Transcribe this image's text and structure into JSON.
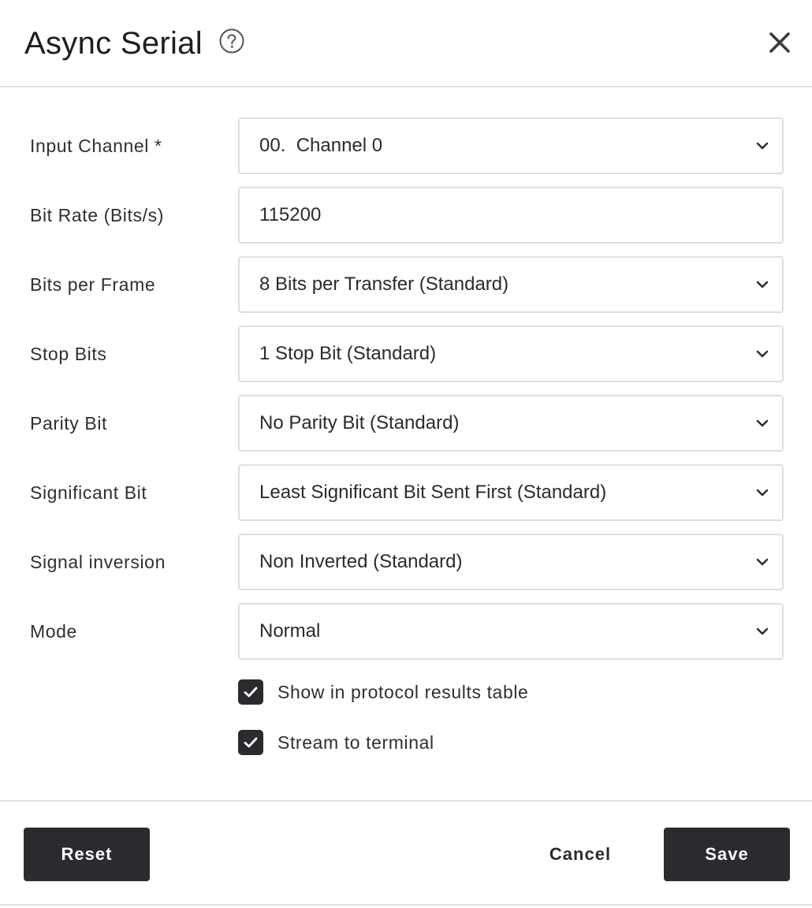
{
  "dialog": {
    "title": "Async Serial",
    "help_icon": "question-circle-icon",
    "close_icon": "close-x-icon"
  },
  "fields": [
    {
      "label": "Input Channel *",
      "value": "00.  Channel 0",
      "type": "select"
    },
    {
      "label": "Bit Rate (Bits/s)",
      "value": "115200",
      "type": "input"
    },
    {
      "label": "Bits per Frame",
      "value": "8 Bits per Transfer (Standard)",
      "type": "select"
    },
    {
      "label": "Stop Bits",
      "value": "1 Stop Bit (Standard)",
      "type": "select"
    },
    {
      "label": "Parity Bit",
      "value": "No Parity Bit (Standard)",
      "type": "select"
    },
    {
      "label": "Significant Bit",
      "value": "Least Significant Bit Sent First (Standard)",
      "type": "select"
    },
    {
      "label": "Signal inversion",
      "value": "Non Inverted (Standard)",
      "type": "select"
    },
    {
      "label": "Mode",
      "value": "Normal",
      "type": "select"
    }
  ],
  "checkboxes": [
    {
      "label": "Show in protocol results table",
      "checked": true
    },
    {
      "label": "Stream to terminal",
      "checked": true
    }
  ],
  "footer": {
    "reset_label": "Reset",
    "cancel_label": "Cancel",
    "save_label": "Save"
  },
  "colors": {
    "button_dark": "#2b2b2f",
    "border": "#dedee2",
    "text": "#2b2b2e"
  }
}
